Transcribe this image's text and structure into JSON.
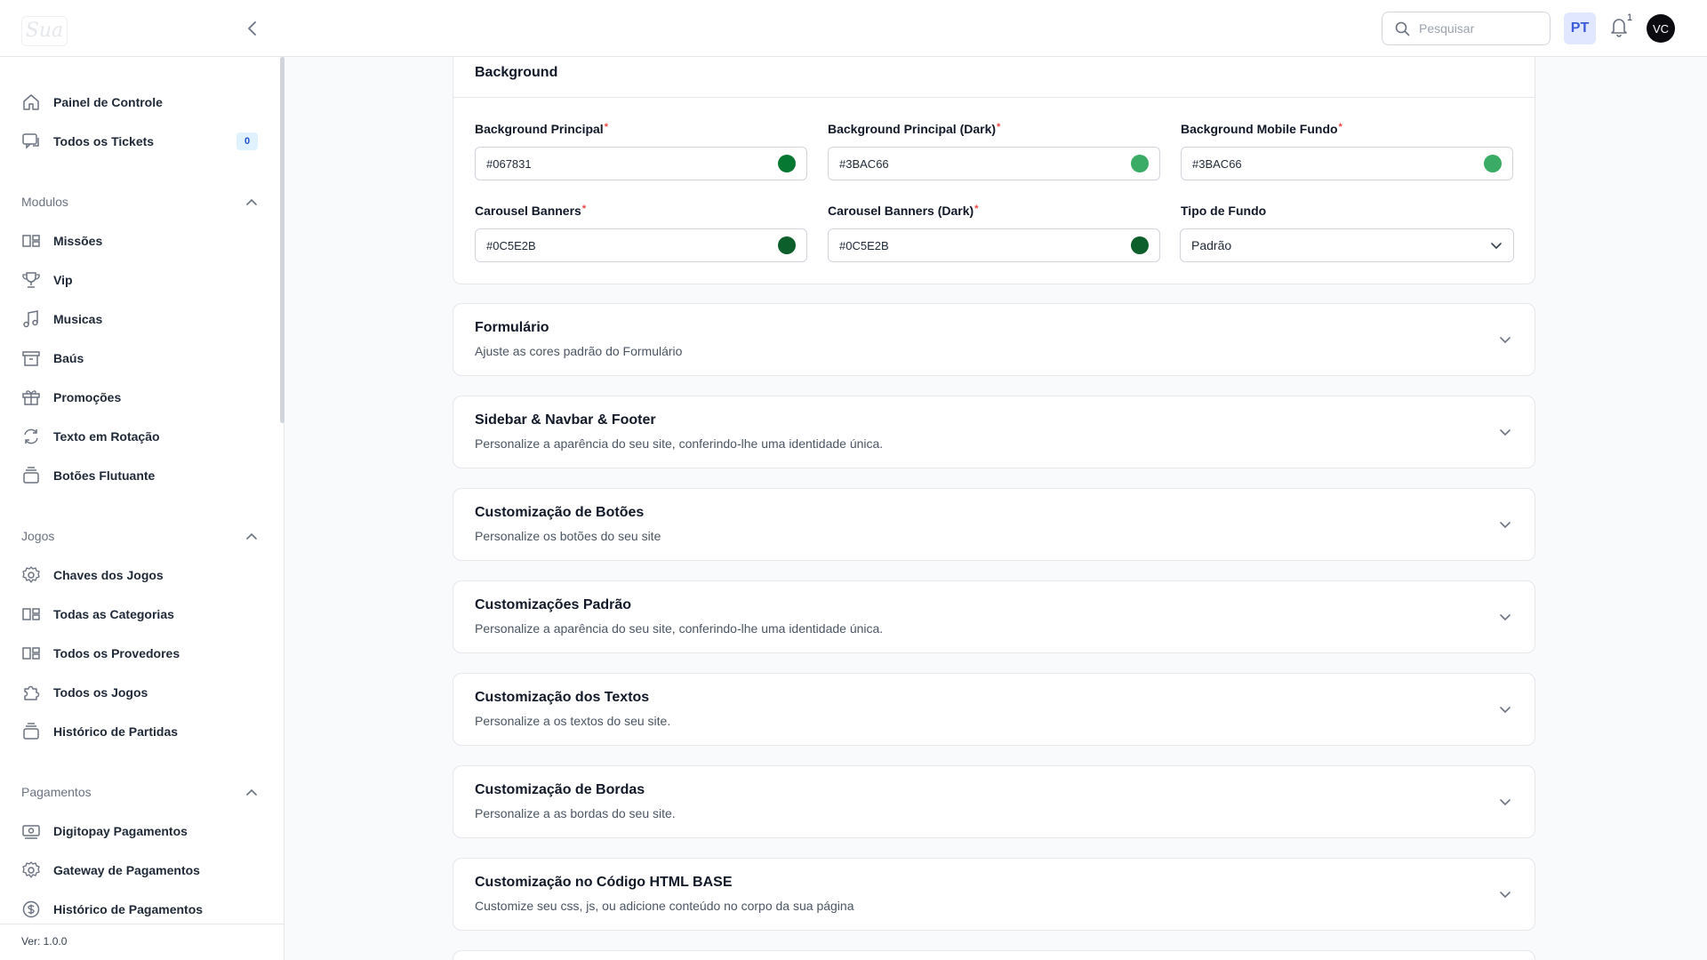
{
  "header": {
    "logo_text": "Sua",
    "search_placeholder": "Pesquisar",
    "language": "PT",
    "notification_count": "1",
    "avatar_initials": "VC"
  },
  "sidebar": {
    "top_items": [
      {
        "label": "Painel de Controle",
        "icon": "home-icon"
      },
      {
        "label": "Todos os Tickets",
        "icon": "chat-icon",
        "badge": "0"
      }
    ],
    "sections": [
      {
        "title": "Modulos",
        "items": [
          {
            "label": "Missões",
            "icon": "layout-icon"
          },
          {
            "label": "Vip",
            "icon": "trophy-icon"
          },
          {
            "label": "Musicas",
            "icon": "music-icon"
          },
          {
            "label": "Baús",
            "icon": "archive-icon"
          },
          {
            "label": "Promoções",
            "icon": "gift-icon"
          },
          {
            "label": "Texto em Rotação",
            "icon": "refresh-icon"
          },
          {
            "label": "Botões Flutuante",
            "icon": "stack-icon"
          }
        ]
      },
      {
        "title": "Jogos",
        "items": [
          {
            "label": "Chaves dos Jogos",
            "icon": "gear-icon"
          },
          {
            "label": "Todas as Categorias",
            "icon": "layout-icon"
          },
          {
            "label": "Todos os Provedores",
            "icon": "layout-icon"
          },
          {
            "label": "Todos os Jogos",
            "icon": "puzzle-icon"
          },
          {
            "label": "Histórico de Partidas",
            "icon": "stack-icon"
          }
        ]
      },
      {
        "title": "Pagamentos",
        "items": [
          {
            "label": "Digitopay Pagamentos",
            "icon": "banknote-icon"
          },
          {
            "label": "Gateway de Pagamentos",
            "icon": "gear-icon"
          },
          {
            "label": "Histórico de Pagamentos",
            "icon": "dollar-icon"
          }
        ]
      }
    ],
    "version": "Ver: 1.0.0"
  },
  "background_section": {
    "title": "Background",
    "fields": [
      {
        "label": "Background Principal",
        "value": "#067831",
        "swatch": "#067831",
        "required": true
      },
      {
        "label": "Background Principal (Dark)",
        "value": "#3BAC66",
        "swatch": "#3BAC66",
        "required": true
      },
      {
        "label": "Background Mobile Fundo",
        "value": "#3BAC66",
        "swatch": "#3BAC66",
        "required": true
      },
      {
        "label": "Carousel Banners",
        "value": "#0C5E2B",
        "swatch": "#0C5E2B",
        "required": true
      },
      {
        "label": "Carousel Banners (Dark)",
        "value": "#0C5E2B",
        "swatch": "#0C5E2B",
        "required": true
      }
    ],
    "select": {
      "label": "Tipo de Fundo",
      "value": "Padrão"
    }
  },
  "accordions": [
    {
      "title": "Formulário",
      "subtitle": "Ajuste as cores padrão do Formulário"
    },
    {
      "title": "Sidebar & Navbar & Footer",
      "subtitle": "Personalize a aparência do seu site, conferindo-lhe uma identidade única."
    },
    {
      "title": "Customização de Botões",
      "subtitle": "Personalize os botões do seu site"
    },
    {
      "title": "Customizações Padrão",
      "subtitle": "Personalize a aparência do seu site, conferindo-lhe uma identidade única."
    },
    {
      "title": "Customização dos Textos",
      "subtitle": "Personalize a os textos do seu site."
    },
    {
      "title": "Customização de Bordas",
      "subtitle": "Personalize a as bordas do seu site."
    },
    {
      "title": "Customização no Código HTML BASE",
      "subtitle": "Customize seu css, js, ou adicione conteúdo no corpo da sua página"
    }
  ]
}
